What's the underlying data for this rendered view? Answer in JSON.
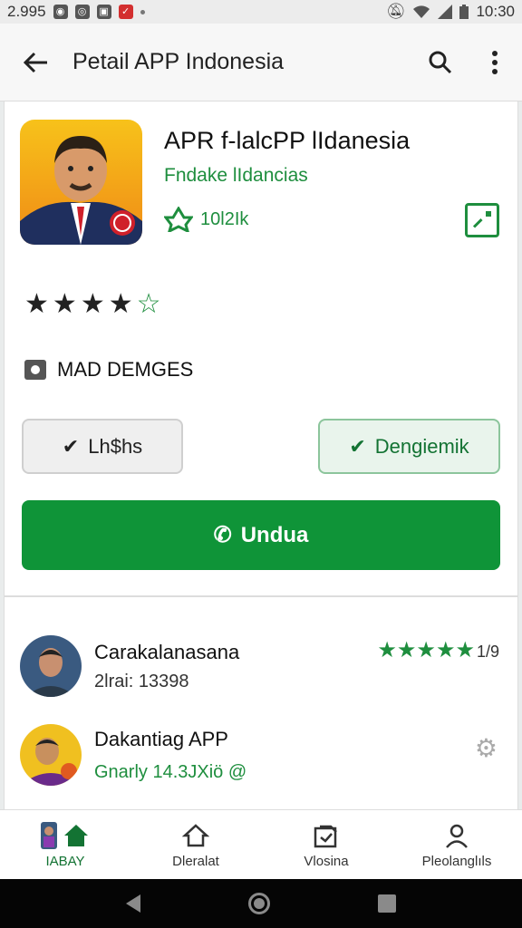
{
  "status_bar": {
    "time_left": "2.995",
    "time": "10:30",
    "icons": [
      "whatsapp-icon",
      "chrome-icon",
      "image-icon",
      "mail-icon",
      "dot-icon",
      "mute-icon",
      "wifi-icon",
      "signal-icon",
      "battery-icon"
    ]
  },
  "app_bar": {
    "title": "Petail APP Indonesia"
  },
  "app": {
    "name": "APR f-lalcPP lIdanesia",
    "developer": "Fndake lIdancias",
    "downloads": "10l2Ik",
    "rating_stars_filled": 4,
    "rating_stars_total": 5,
    "badge": "MAD DEMGES"
  },
  "actions": {
    "left_chip": "Lh$hs",
    "right_chip": "Dengiemik",
    "install": "Undua"
  },
  "similar": [
    {
      "title": "Carakalanasana",
      "subtitle": "2lrai: 13398",
      "rating_text": "1/9"
    },
    {
      "title": "Dakantiag APP",
      "subtitle": "Gnarly 14.3JXiö @"
    }
  ],
  "bottom_nav": [
    {
      "label": "IABAY",
      "icon": "home-icon"
    },
    {
      "label": "Dleralat",
      "icon": "house-outline-icon"
    },
    {
      "label": "Vlosina",
      "icon": "clipboard-icon"
    },
    {
      "label": "Pleolanglıls",
      "icon": "person-icon"
    }
  ],
  "colors": {
    "accent": "#0f9438",
    "green_text": "#1e8e3e"
  }
}
